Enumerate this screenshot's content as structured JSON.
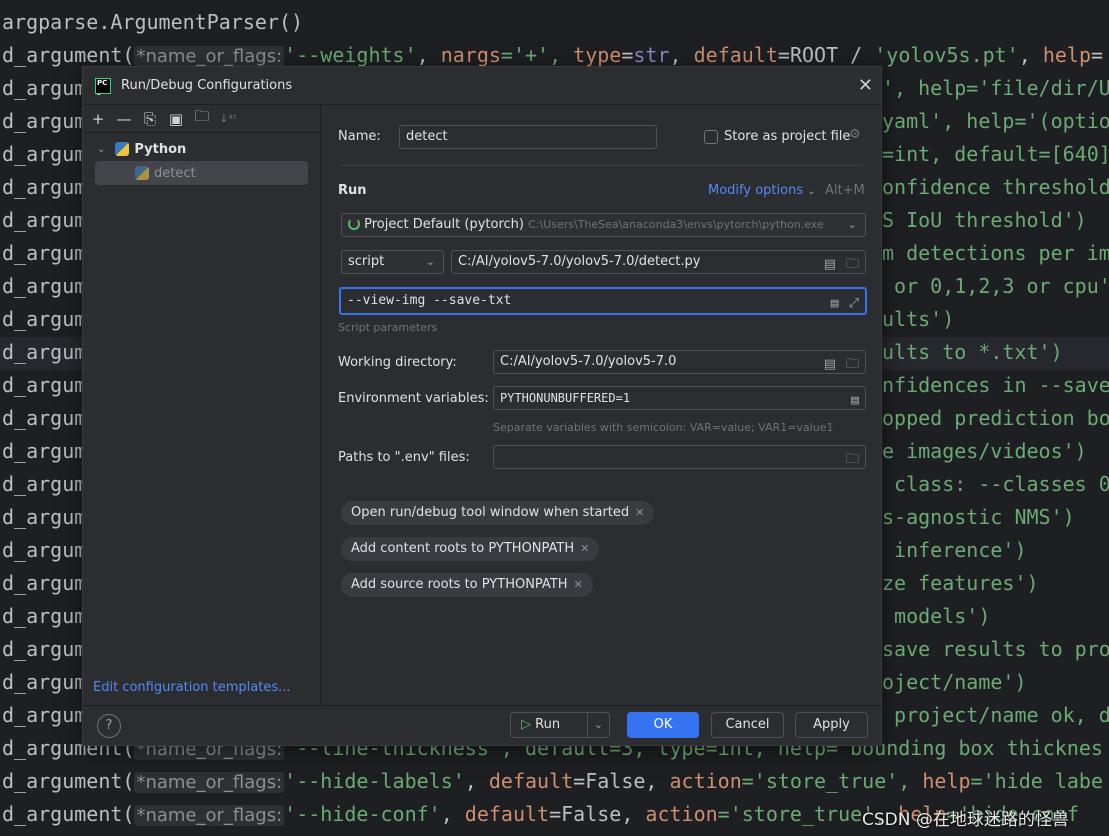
{
  "editor": {
    "line1": "argparse.ArgumentParser()",
    "hint": "*name_or_flags:",
    "call_prefix": "d_argument(",
    "call_prefix_short": "d_argum",
    "weights": {
      "arg": "'--weights'",
      "rest1": ", ",
      "nargs": "nargs",
      "eq1": "='+', ",
      "type": "type",
      "eq2": "=",
      "str": "str",
      ", ": ", ",
      "default": "default",
      "val": "=ROOT / ",
      "file": "'yolov5s.pt'",
      "c": ", ",
      "help": "help",
      "tail": "="
    },
    "right_lines": [
      "', help='file/dir/U",
      "yaml', help='(optio",
      "=int, default=[640]",
      "onfidence threshold",
      "S IoU threshold')",
      "m detections per im",
      " or 0,1,2,3 or cpu'",
      "ults')",
      "ults to *.txt')",
      "nfidences in --save",
      "opped prediction bo",
      "e images/videos')",
      " class: --classes 0",
      "s-agnostic NMS')",
      " inference')",
      "ze features')",
      " models')",
      "save results to pro",
      "oject/name')",
      " project/name ok, d"
    ],
    "line_thickness": "'--line-thickness', default=3, type=int, help='bounding box thicknes",
    "hide_labels": {
      "arg": "'--hide-labels'",
      "d": "default",
      "v": "=False, ",
      "a": "action",
      "av": "='store_true', ",
      "h": "help",
      "hv": "='hide labe"
    },
    "hide_conf": {
      "arg": "'--hide-conf'",
      "d": "default",
      "v": "=False, ",
      "a": "action",
      "av": "='store_true', ",
      "h": "help",
      "hv": "='hide conf"
    },
    "watermark": "CSDN @在地球迷路的怪兽"
  },
  "dialog": {
    "title": "Run/Debug Configurations",
    "toolbar_icons": [
      "add-icon",
      "remove-icon",
      "copy-icon",
      "save-icon",
      "new-folder-icon",
      "sort-icon"
    ],
    "tree": {
      "group": "Python",
      "item": "detect"
    },
    "edit_templates": "Edit configuration templates...",
    "name_label": "Name:",
    "name_value": "detect",
    "store_label": "Store as project file",
    "run_heading": "Run",
    "modify_options": "Modify options",
    "modify_shortcut": "Alt+M",
    "interpreter": "Project Default (pytorch)",
    "interpreter_path": "C:\\Users\\TheSea\\anaconda3\\envs\\pytorch\\python.exe",
    "script_type": "script",
    "script_path": "C:/AI/yolov5-7.0/yolov5-7.0/detect.py",
    "script_params": "--view-img --save-txt",
    "script_params_label": "Script parameters",
    "workdir_label": "Working directory:",
    "workdir_value": "C:/AI/yolov5-7.0/yolov5-7.0",
    "env_label": "Environment variables:",
    "env_value": "PYTHONUNBUFFERED=1",
    "env_hint": "Separate variables with semicolon: VAR=value; VAR1=value1",
    "dotenv_label": "Paths to \".env\" files:",
    "dotenv_value": "",
    "chips": [
      "Open run/debug tool window when started",
      "Add content roots to PYTHONPATH",
      "Add source roots to PYTHONPATH"
    ],
    "buttons": {
      "help": "?",
      "run": "Run",
      "ok": "OK",
      "cancel": "Cancel",
      "apply": "Apply"
    }
  },
  "colors": {
    "accent": "#3574f0",
    "link": "#548af7",
    "bg": "#2b2d30",
    "editor_bg": "#1e1f22"
  }
}
